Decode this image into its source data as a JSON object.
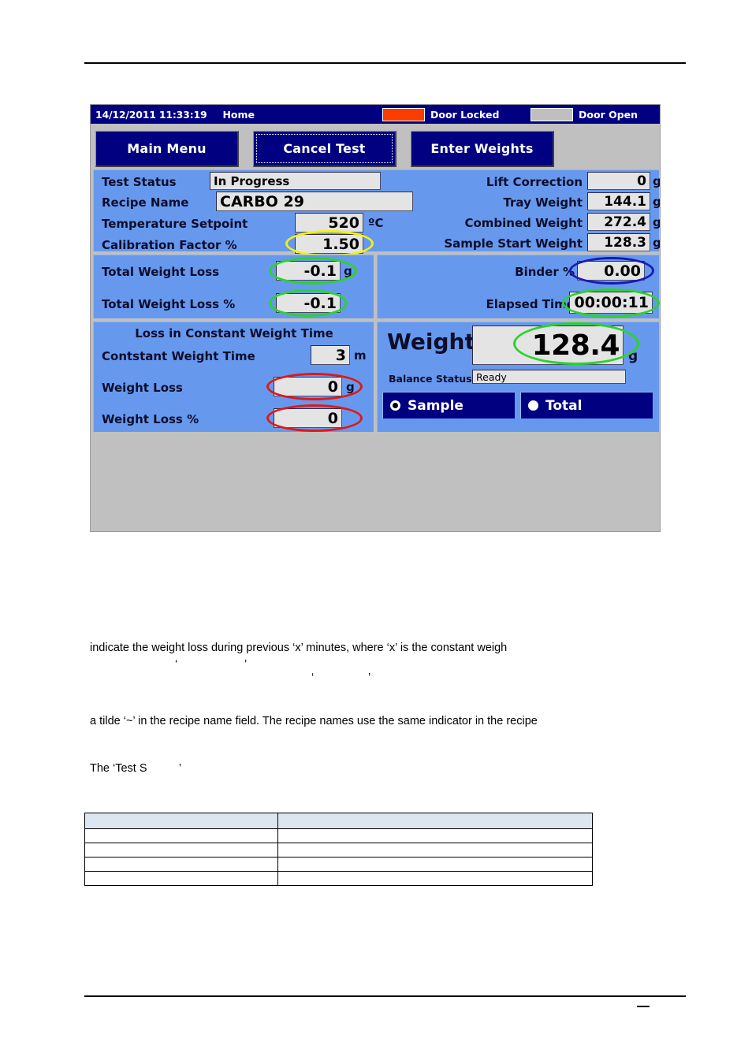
{
  "document": {
    "paragraphs": [
      "indicate the weight loss during previous ‘x’ minutes, where ‘x’ is the constant weigh",
      "a tilde ‘~’ in the recipe name field. The recipe names use the same indicator in the recipe",
      "The ‘Test S          ’"
    ],
    "stray_marks": [
      "‘",
      "’",
      "‘",
      "’"
    ],
    "table": {
      "header": [
        "",
        ""
      ],
      "rows": [
        [
          "",
          ""
        ],
        [
          "",
          ""
        ],
        [
          "",
          ""
        ],
        [
          "",
          ""
        ]
      ]
    },
    "footer_mark": ""
  },
  "hmi": {
    "titlebar": {
      "datetime": "14/12/2011 11:33:19",
      "screen_name": "Home",
      "door_locked_label": "Door Locked",
      "door_open_label": "Door Open",
      "door_locked_color": "#fa3c00",
      "door_open_color": "#bfbfbf"
    },
    "buttons": [
      {
        "id": "main-menu",
        "label": "Main Menu",
        "focused": false
      },
      {
        "id": "cancel-test",
        "label": "Cancel Test",
        "focused": true
      },
      {
        "id": "enter-weights",
        "label": "Enter Weights",
        "focused": false
      }
    ],
    "top_panel": {
      "left": [
        {
          "label": "Test Status",
          "value": "In Progress",
          "unit": ""
        },
        {
          "label": "Recipe Name",
          "value": "CARBO 29",
          "unit": ""
        },
        {
          "label": "Temperature Setpoint",
          "value": "520",
          "unit": "ºC"
        },
        {
          "label": "Calibration Factor %",
          "value": "1.50",
          "unit": ""
        }
      ],
      "right": [
        {
          "label": "Lift Correction",
          "value": "0",
          "unit": "g"
        },
        {
          "label": "Tray Weight",
          "value": "144.1",
          "unit": "g"
        },
        {
          "label": "Combined Weight",
          "value": "272.4",
          "unit": "g"
        },
        {
          "label": "Sample Start Weight",
          "value": "128.3",
          "unit": "g"
        }
      ]
    },
    "mid_left": [
      {
        "label": "Total Weight Loss",
        "value": "-0.1",
        "unit": "g"
      },
      {
        "label": "Total Weight Loss %",
        "value": "-0.1",
        "unit": ""
      }
    ],
    "mid_right": [
      {
        "label": "Binder %",
        "value": "0.00",
        "unit": ""
      },
      {
        "label": "Elapsed Time",
        "value": "00:00:11",
        "unit": ""
      }
    ],
    "bottom_left": {
      "group_title": "Loss in Constant Weight Time",
      "rows": [
        {
          "label": "Contstant Weight Time",
          "value": "3",
          "unit": "m"
        },
        {
          "label": "Weight Loss",
          "value": "0",
          "unit": "g"
        },
        {
          "label": "Weight Loss %",
          "value": "0",
          "unit": ""
        }
      ]
    },
    "bottom_right": {
      "weight_label": "Weight",
      "weight_value": "128.4",
      "weight_unit": "g",
      "balance_status_label": "Balance Status",
      "balance_status_value": "Ready",
      "radios": [
        {
          "label": "Sample",
          "selected": true
        },
        {
          "label": "Total",
          "selected": false
        }
      ]
    },
    "annotations": [
      {
        "target": "calibration-factor",
        "color": "#f2f20a",
        "shape": "ellipse"
      },
      {
        "target": "total-weight-loss",
        "color": "#2ad42a",
        "shape": "ellipse"
      },
      {
        "target": "total-weight-loss-pct",
        "color": "#2ad42a",
        "shape": "ellipse"
      },
      {
        "target": "binder-pct",
        "color": "#1a1ab4",
        "shape": "ellipse"
      },
      {
        "target": "elapsed-time",
        "color": "#2ad42a",
        "shape": "ellipse"
      },
      {
        "target": "weight-loss",
        "color": "#e01818",
        "shape": "ellipse"
      },
      {
        "target": "weight-loss-pct",
        "color": "#e01818",
        "shape": "ellipse"
      },
      {
        "target": "weight-display",
        "color": "#2ad42a",
        "shape": "ellipse"
      }
    ]
  }
}
